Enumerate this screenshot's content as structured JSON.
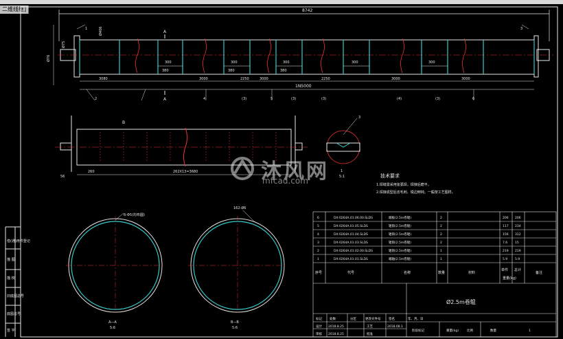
{
  "window": {
    "tab_label": "二维线框]"
  },
  "top_view": {
    "overall_dim": "8742",
    "roll_len_dim": "1N5000",
    "left_dims": [
      "Ø76",
      "Ø75",
      "Ø406"
    ],
    "segment_dims": [
      "3080",
      "3000",
      "3000",
      "2250",
      "2250",
      "3000",
      "3000"
    ],
    "small_dims": [
      "300",
      "380",
      "300",
      "380",
      "300",
      "380",
      "300",
      "300"
    ],
    "section_marks": [
      "A",
      "A"
    ],
    "balloons": [
      "1",
      "2",
      "3",
      "4",
      "5",
      "6",
      "(3)",
      "(3)",
      "(3)",
      "(4)",
      "(3)"
    ]
  },
  "side_view": {
    "section_mark": "B",
    "dims": [
      "260",
      "262X13=3680"
    ],
    "left_dim": "56"
  },
  "detail": {
    "label": "3",
    "note": "1",
    "scale": "5:1"
  },
  "tech_req": {
    "title": "技术要求",
    "lines": [
      "1.焊缝需采用氩弧焊，焊接后磨平，",
      "2.焊接成型后去毛刺、锐边倒钝，一般按工艺图样。"
    ]
  },
  "sections": [
    {
      "label": "A—A",
      "scale": "5:6",
      "annot": "6-Φ5(均布圆)"
    },
    {
      "label": "B—B",
      "scale": "5:6",
      "annot": "162-Ø6"
    }
  ],
  "title_block": {
    "parts": [
      {
        "no": "6",
        "code": "DX-0264A.01.06.00.SLDS",
        "name": "端板(2.5m卷辊)",
        "qty": "2",
        "w1": "206",
        "w2": "206"
      },
      {
        "no": "5",
        "code": "DX-0264A.01.05.SLDS",
        "name": "辊筒(2.5m卷辊)",
        "qty": "2",
        "w1": "117",
        "w2": "234"
      },
      {
        "no": "4",
        "code": "DX-0264A.01.04.SLDS",
        "name": "辊筒(2.5m卷辊)",
        "qty": "2",
        "w1": "156",
        "w2": "312"
      },
      {
        "no": "3",
        "code": "DX-0264A.01.03.SLDS",
        "name": "辊筒(2.5m卷辊)",
        "qty": "2",
        "w1": "7.6",
        "w2": "15"
      },
      {
        "no": "2",
        "code": "DX-0264A.01.02.00.SLDS",
        "name": "辊筒(2.5m卷辊)",
        "qty": "1",
        "w1": "219",
        "w2": "219"
      },
      {
        "no": "1",
        "code": "DX-0264A.01.01.SLDS",
        "name": "端轴(2.5m卷辊)",
        "qty": "1",
        "w1": "5.9",
        "w2": "5.9"
      }
    ],
    "headers": {
      "no": "序号",
      "code": "代号",
      "name": "名称",
      "qty": "数量",
      "material": "材料",
      "single": "单件",
      "total": "总计",
      "weight": "重量(kg)",
      "remark": "备注"
    },
    "drawing_title": "Ø2.5m卷辊",
    "sign_row": [
      "标记",
      "处数",
      "分区",
      "更改文件号",
      "签名",
      "年、月、日"
    ],
    "design_row": [
      "设计",
      "2018.8.25",
      "工艺",
      "2018.08.1"
    ],
    "review_row": [
      "审核",
      "2018.8.25",
      "批准"
    ],
    "stage_row": [
      "阶段标记",
      "重量(kg)",
      "比例"
    ],
    "qty_label": "数量",
    "qty_value": "1"
  },
  "left_panel": [
    "借(通)用件登记",
    "描 图",
    "描 校",
    "旧底图总号",
    "底图总号",
    "签 字"
  ],
  "watermark": {
    "main": "沐风网",
    "sub": "mfcad.com"
  }
}
